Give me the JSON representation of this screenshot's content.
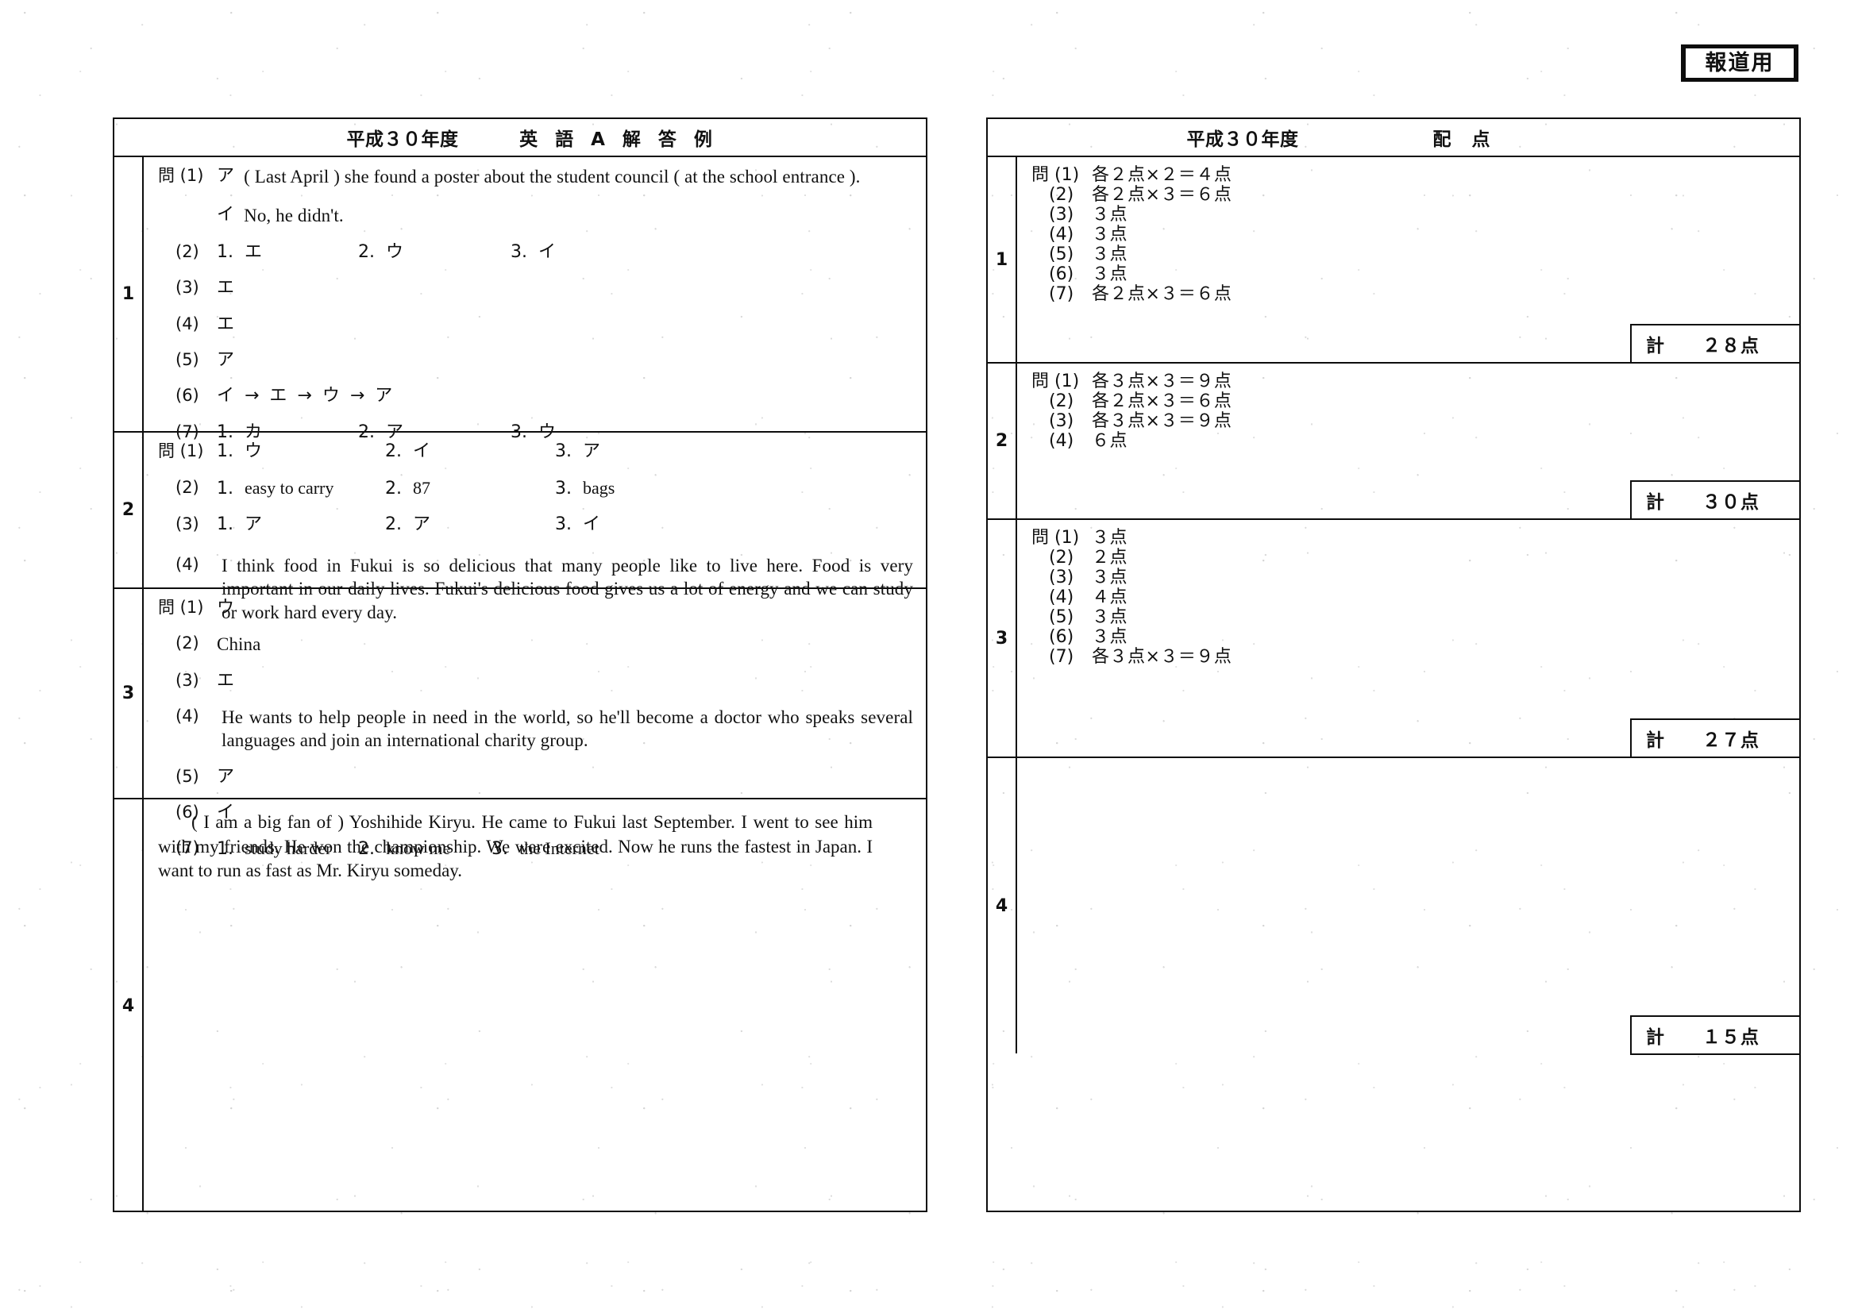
{
  "badge": {
    "label": "報道用"
  },
  "answer_panel": {
    "header": {
      "year": "平成３０年度",
      "title": "英 語 A 解 答 例"
    },
    "sections": [
      {
        "number": "1",
        "items": [
          {
            "label": "問 (1)",
            "kana": "ア",
            "text": "( Last April ) she found a poster about the student council ( at the school entrance )."
          },
          {
            "label": "",
            "kana": "イ",
            "text": "No, he didn't."
          },
          {
            "label": "(2)",
            "cols": [
              {
                "n": "1.",
                "v": "エ"
              },
              {
                "n": "2.",
                "v": "ウ"
              },
              {
                "n": "3.",
                "v": "イ"
              }
            ]
          },
          {
            "label": "(3)",
            "kana": "エ"
          },
          {
            "label": "(4)",
            "kana": "エ"
          },
          {
            "label": "(5)",
            "kana": "ア"
          },
          {
            "label": "(6)",
            "seq": "イ → エ → ウ → ア"
          },
          {
            "label": "(7)",
            "cols": [
              {
                "n": "1.",
                "v": "カ"
              },
              {
                "n": "2.",
                "v": "ア"
              },
              {
                "n": "3.",
                "v": "ウ"
              }
            ]
          }
        ]
      },
      {
        "number": "2",
        "items": [
          {
            "label": "問 (1)",
            "cols": [
              {
                "n": "1.",
                "v": "ウ"
              },
              {
                "n": "2.",
                "v": "イ"
              },
              {
                "n": "3.",
                "v": "ア"
              }
            ]
          },
          {
            "label": "(2)",
            "cols": [
              {
                "n": "1.",
                "v": "easy to carry"
              },
              {
                "n": "2.",
                "v": "87"
              },
              {
                "n": "3.",
                "v": "bags"
              }
            ]
          },
          {
            "label": "(3)",
            "cols": [
              {
                "n": "1.",
                "v": "ア"
              },
              {
                "n": "2.",
                "v": "ア"
              },
              {
                "n": "3.",
                "v": "イ"
              }
            ]
          },
          {
            "label": "(4)",
            "text": "I think food in Fukui is so delicious that many people like to live here. Food is very important in our daily lives.  Fukui's delicious food gives us a lot of energy and we can study or work hard every day."
          }
        ]
      },
      {
        "number": "3",
        "items": [
          {
            "label": "問 (1)",
            "kana": "ウ"
          },
          {
            "label": "(2)",
            "text": "China"
          },
          {
            "label": "(3)",
            "kana": "エ"
          },
          {
            "label": "(4)",
            "text": "He wants to help people in need in the world, so he'll become a doctor who speaks several languages and join an international charity group."
          },
          {
            "label": "(5)",
            "kana": "ア"
          },
          {
            "label": "(6)",
            "kana": "イ"
          },
          {
            "label": "(7)",
            "cols": [
              {
                "n": "1.",
                "v": "study harder"
              },
              {
                "n": "2.",
                "v": "know me"
              },
              {
                "n": "3.",
                "v": "the Internet"
              }
            ]
          }
        ]
      },
      {
        "number": "4",
        "paragraph": "( I am a big fan of ) Yoshihide Kiryu.  He came to Fukui last September.  I went to see him with my friends.  He won the championship.  We were excited.  Now he runs the fastest in Japan.  I want to run as fast as Mr. Kiryu someday."
      }
    ]
  },
  "points_panel": {
    "header": {
      "year": "平成３０年度",
      "title": "配 点"
    },
    "total_label": "計",
    "sections": [
      {
        "number": "1",
        "items": [
          {
            "label": "問 (1)",
            "value": "各２点×２＝４点"
          },
          {
            "label": "(2)",
            "value": "各２点×３＝６点"
          },
          {
            "label": "(3)",
            "value": "３点"
          },
          {
            "label": "(4)",
            "value": "３点"
          },
          {
            "label": "(5)",
            "value": "３点"
          },
          {
            "label": "(6)",
            "value": "３点"
          },
          {
            "label": "(7)",
            "value": "各２点×３＝６点"
          }
        ],
        "total": "２８点"
      },
      {
        "number": "2",
        "items": [
          {
            "label": "問 (1)",
            "value": "各３点×３＝９点"
          },
          {
            "label": "(2)",
            "value": "各２点×３＝６点"
          },
          {
            "label": "(3)",
            "value": "各３点×３＝９点"
          },
          {
            "label": "(4)",
            "value": "６点"
          }
        ],
        "total": "３０点"
      },
      {
        "number": "3",
        "items": [
          {
            "label": "問 (1)",
            "value": "３点"
          },
          {
            "label": "(2)",
            "value": "２点"
          },
          {
            "label": "(3)",
            "value": "３点"
          },
          {
            "label": "(4)",
            "value": "４点"
          },
          {
            "label": "(5)",
            "value": "３点"
          },
          {
            "label": "(6)",
            "value": "３点"
          },
          {
            "label": "(7)",
            "value": "各３点×３＝９点"
          }
        ],
        "total": "２７点"
      },
      {
        "number": "4",
        "items": [],
        "total": "１５点"
      }
    ]
  }
}
